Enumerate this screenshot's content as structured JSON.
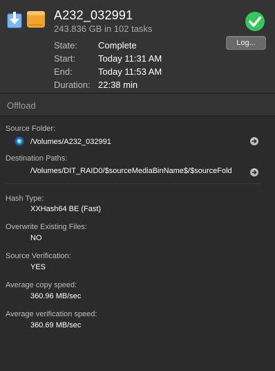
{
  "header": {
    "title": "A232_032991",
    "subtitle": "243.836 GB in 102 tasks",
    "log_button": "Log...",
    "details": [
      {
        "key": "State:",
        "value": "Complete"
      },
      {
        "key": "Start:",
        "value": "Today 11:31 AM"
      },
      {
        "key": "End:",
        "value": "Today 11:53 AM"
      },
      {
        "key": "Duration:",
        "value": "22:38 min"
      }
    ]
  },
  "section": {
    "title": "Offload"
  },
  "offload": {
    "source_folder_label": "Source Folder:",
    "source_folder_value": "/Volumes/A232_032991",
    "destination_paths_label": "Destination Paths:",
    "destination_paths_value": "/Volumes/DIT_RAID0/$sourceMediaBinName$/$sourceFold",
    "hash_type_label": "Hash Type:",
    "hash_type_value": "XXHash64 BE (Fast)",
    "overwrite_label": "Overwrite Existing Files:",
    "overwrite_value": "NO",
    "source_verification_label": "Source Verification:",
    "source_verification_value": "YES",
    "avg_copy_speed_label": "Average copy speed:",
    "avg_copy_speed_value": "360.96 MB/sec",
    "avg_verification_speed_label": "Average verification speed:",
    "avg_verification_speed_value": "360.69 MB/sec"
  },
  "icons": {
    "download": "download-icon",
    "drive": "drive-icon",
    "success": "checkmark-circle-icon",
    "volume": "volume-icon",
    "arrow": "arrow-right-circle-icon"
  },
  "colors": {
    "background": "#2b2b2b",
    "header_background": "#343434",
    "success_green": "#35c759",
    "accent_blue": "#2f7bdc",
    "drive_orange": "#f0a531"
  }
}
